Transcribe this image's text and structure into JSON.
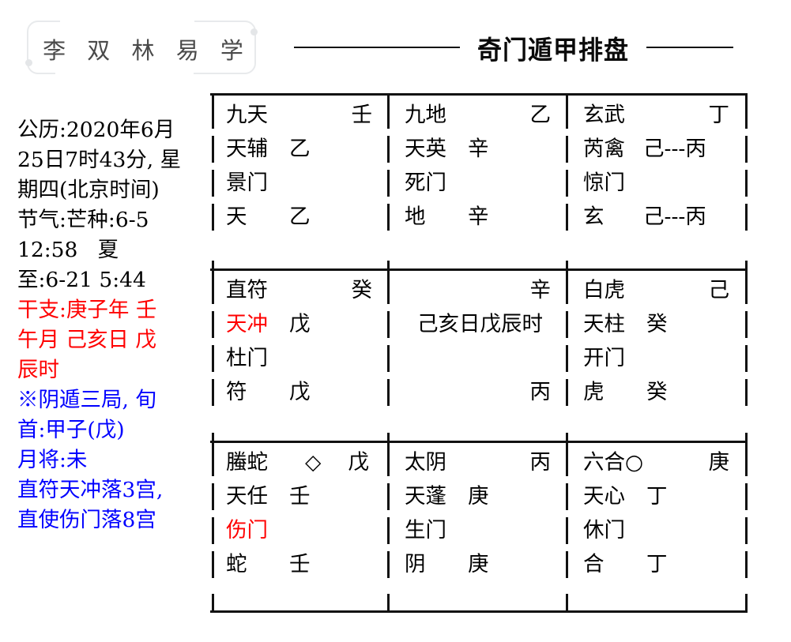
{
  "header": {
    "brand": "李 双 林 易 学",
    "title": "奇门遁甲排盘",
    "rule_icon": "horizontal-rule"
  },
  "info_lines": [
    {
      "text": "公历:2020年6月",
      "color": "black"
    },
    {
      "text": "25日7时43分, 星",
      "color": "black"
    },
    {
      "text": "期四(北京时间)",
      "color": "black"
    },
    {
      "text": "节气:芒种:6-5",
      "color": "black"
    },
    {
      "text": "12:58   夏",
      "color": "black"
    },
    {
      "text": "至:6-21 5:44",
      "color": "black"
    },
    {
      "text": "干支:庚子年 壬",
      "color": "red"
    },
    {
      "text": "午月 己亥日 戊",
      "color": "red"
    },
    {
      "text": "辰时",
      "color": "red"
    },
    {
      "text": "※阴遁三局, 旬",
      "color": "blue"
    },
    {
      "text": "首:甲子(戊)",
      "color": "blue"
    },
    {
      "text": "月将:未",
      "color": "blue"
    },
    {
      "text": "直符天冲落3宫,",
      "color": "blue"
    },
    {
      "text": "直使伤门落8宫",
      "color": "blue"
    }
  ],
  "colors": {
    "black": "#000000",
    "red": "#ff0000",
    "blue": "#0000ff",
    "rule": "#111111",
    "brand_border": "#e8eaec",
    "brand_text": "#4a4a4a"
  },
  "palace_grid": {
    "rows": 3,
    "cols": 3,
    "cells": [
      {
        "position": "top-left",
        "god": "九天",
        "god_stem": "壬",
        "star": "天辅",
        "star_stem": "乙",
        "door": "景门",
        "door_red": false,
        "star_red": false,
        "foot_god": "天",
        "foot_stem": "乙",
        "marker": ""
      },
      {
        "position": "top-center",
        "god": "九地",
        "god_stem": "乙",
        "star": "天英",
        "star_stem": "辛",
        "door": "死门",
        "door_red": false,
        "star_red": false,
        "foot_god": "地",
        "foot_stem": "辛",
        "marker": ""
      },
      {
        "position": "top-right",
        "god": "玄武",
        "god_stem": "丁",
        "star": "芮禽",
        "star_stem": "己---丙",
        "door": "惊门",
        "door_red": false,
        "star_red": false,
        "foot_god": "玄",
        "foot_stem": "己---丙",
        "marker": ""
      },
      {
        "position": "middle-left",
        "god": "直符",
        "god_stem": "癸",
        "star": "天冲",
        "star_stem": "戊",
        "door": "杜门",
        "door_red": false,
        "star_red": true,
        "foot_god": "符",
        "foot_stem": "戊",
        "marker": ""
      },
      {
        "position": "center",
        "god": "",
        "god_stem": "辛",
        "star": "",
        "star_stem": "",
        "center_text": "己亥日戊辰时",
        "door": "",
        "door_red": false,
        "star_red": false,
        "foot_god": "",
        "foot_stem": "丙",
        "marker": ""
      },
      {
        "position": "middle-right",
        "god": "白虎",
        "god_stem": "己",
        "star": "天柱",
        "star_stem": "癸",
        "door": "开门",
        "door_red": false,
        "star_red": false,
        "foot_god": "虎",
        "foot_stem": "癸",
        "marker": ""
      },
      {
        "position": "bottom-left",
        "god": "螣蛇",
        "god_stem": "戊",
        "star": "天任",
        "star_stem": "壬",
        "door": "伤门",
        "door_red": true,
        "star_red": false,
        "foot_god": "蛇",
        "foot_stem": "壬",
        "marker": "◇"
      },
      {
        "position": "bottom-center",
        "god": "太阴",
        "god_stem": "丙",
        "star": "天蓬",
        "star_stem": "庚",
        "door": "生门",
        "door_red": false,
        "star_red": false,
        "foot_god": "阴",
        "foot_stem": "庚",
        "marker": ""
      },
      {
        "position": "bottom-right",
        "god": "六合○",
        "god_stem": "庚",
        "star": "天心",
        "star_stem": "丁",
        "door": "休门",
        "door_red": false,
        "star_red": false,
        "foot_god": "合",
        "foot_stem": "丁",
        "marker": ""
      }
    ]
  }
}
